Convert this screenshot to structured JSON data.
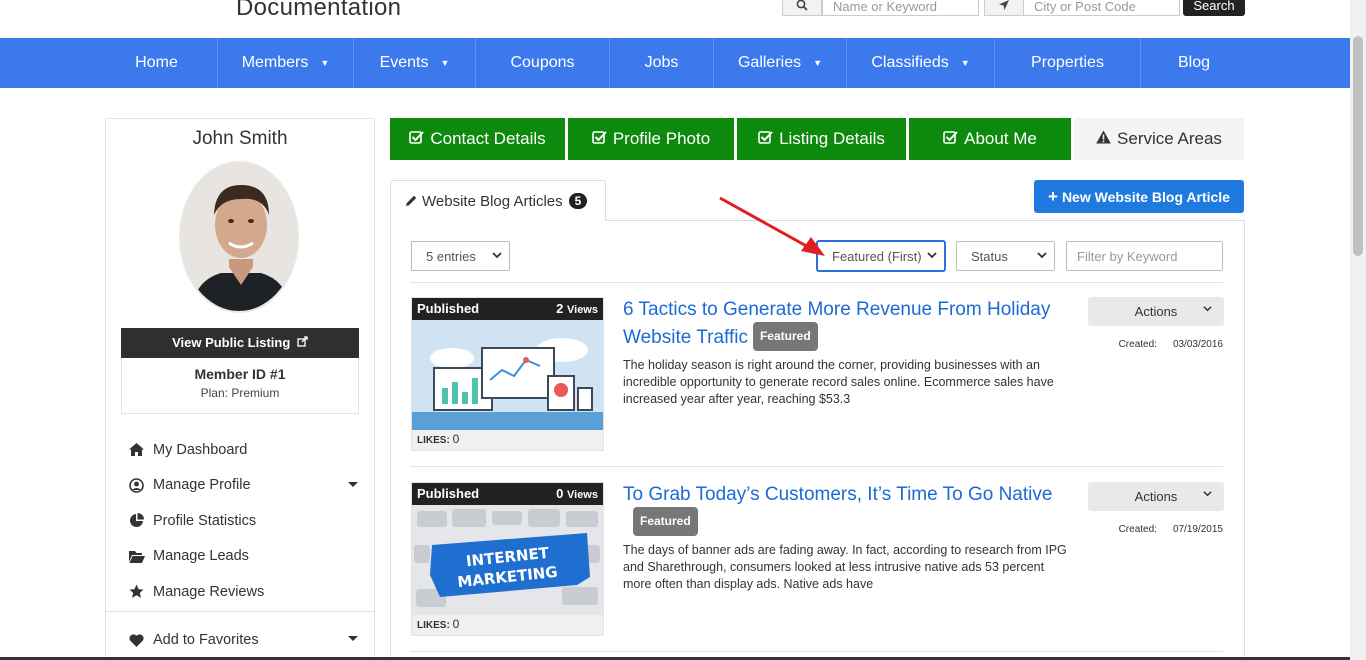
{
  "header": {
    "logo_text": "Documentation",
    "search": {
      "keyword_placeholder": "Name or Keyword",
      "location_placeholder": "City or Post Code",
      "submit_label": "Search"
    }
  },
  "nav": {
    "items": [
      {
        "label": "Home",
        "has_caret": false
      },
      {
        "label": "Members",
        "has_caret": true
      },
      {
        "label": "Events",
        "has_caret": true
      },
      {
        "label": "Coupons",
        "has_caret": false
      },
      {
        "label": "Jobs",
        "has_caret": false
      },
      {
        "label": "Galleries",
        "has_caret": true
      },
      {
        "label": "Classifieds",
        "has_caret": true
      },
      {
        "label": "Properties",
        "has_caret": false
      },
      {
        "label": "Blog",
        "has_caret": false
      }
    ]
  },
  "sidebar": {
    "name": "John Smith",
    "view_listing_label": "View Public Listing",
    "member_id": "Member ID #1",
    "plan": "Plan: Premium",
    "menu": [
      {
        "label": "My Dashboard",
        "icon": "home-icon",
        "has_caret": false
      },
      {
        "label": "Manage Profile",
        "icon": "user-circle-icon",
        "has_caret": true
      },
      {
        "label": "Profile Statistics",
        "icon": "pie-chart-icon",
        "has_caret": false
      },
      {
        "label": "Manage Leads",
        "icon": "folder-open-icon",
        "has_caret": false
      },
      {
        "label": "Manage Reviews",
        "icon": "star-icon",
        "has_caret": false
      }
    ],
    "favorites_label": "Add to Favorites"
  },
  "steps": [
    {
      "label": "Contact Details",
      "complete": true
    },
    {
      "label": "Profile Photo",
      "complete": true
    },
    {
      "label": "Listing Details",
      "complete": true
    },
    {
      "label": "About Me",
      "complete": true
    },
    {
      "label": "Service Areas",
      "complete": false
    }
  ],
  "panel": {
    "tab_label": "Website Blog Articles",
    "tab_count": "5",
    "new_button_label": "New Website Blog Article",
    "entries_select": "5 entries",
    "sort_select": "Featured (First)",
    "status_select": "Status",
    "filter_placeholder": "Filter by Keyword"
  },
  "articles": [
    {
      "status": "Published",
      "views_count": "2",
      "views_label": "Views",
      "likes_label": "LIKES:",
      "likes": "0",
      "title": "6 Tactics to Generate More Revenue From Holiday Website Traffic",
      "badge": "Featured",
      "description": "The holiday season is right around the corner, providing businesses with an incredible opportunity to generate record sales online. Ecommerce sales have increased year after year, reaching $53.3",
      "actions_label": "Actions",
      "created_label": "Created:",
      "created_date": "03/03/2016"
    },
    {
      "status": "Published",
      "views_count": "0",
      "views_label": "Views",
      "likes_label": "LIKES:",
      "likes": "0",
      "title": "To Grab Today’s Customers, It’s Time To Go Native",
      "badge": "Featured",
      "description": "The days of banner ads are fading away. In fact, according to research from IPG and Sharethrough, consumers looked at less intrusive native ads 53 percent more often than display ads. Native ads have",
      "actions_label": "Actions",
      "created_label": "Created:",
      "created_date": "07/19/2015",
      "image_text": "INTERNET MARKETING"
    }
  ],
  "colors": {
    "nav_bg": "#3c79ed",
    "step_complete": "#0d8a0d",
    "link": "#1b6ad8",
    "new_button": "#1f7ae0",
    "annotation_arrow": "#e02020"
  }
}
